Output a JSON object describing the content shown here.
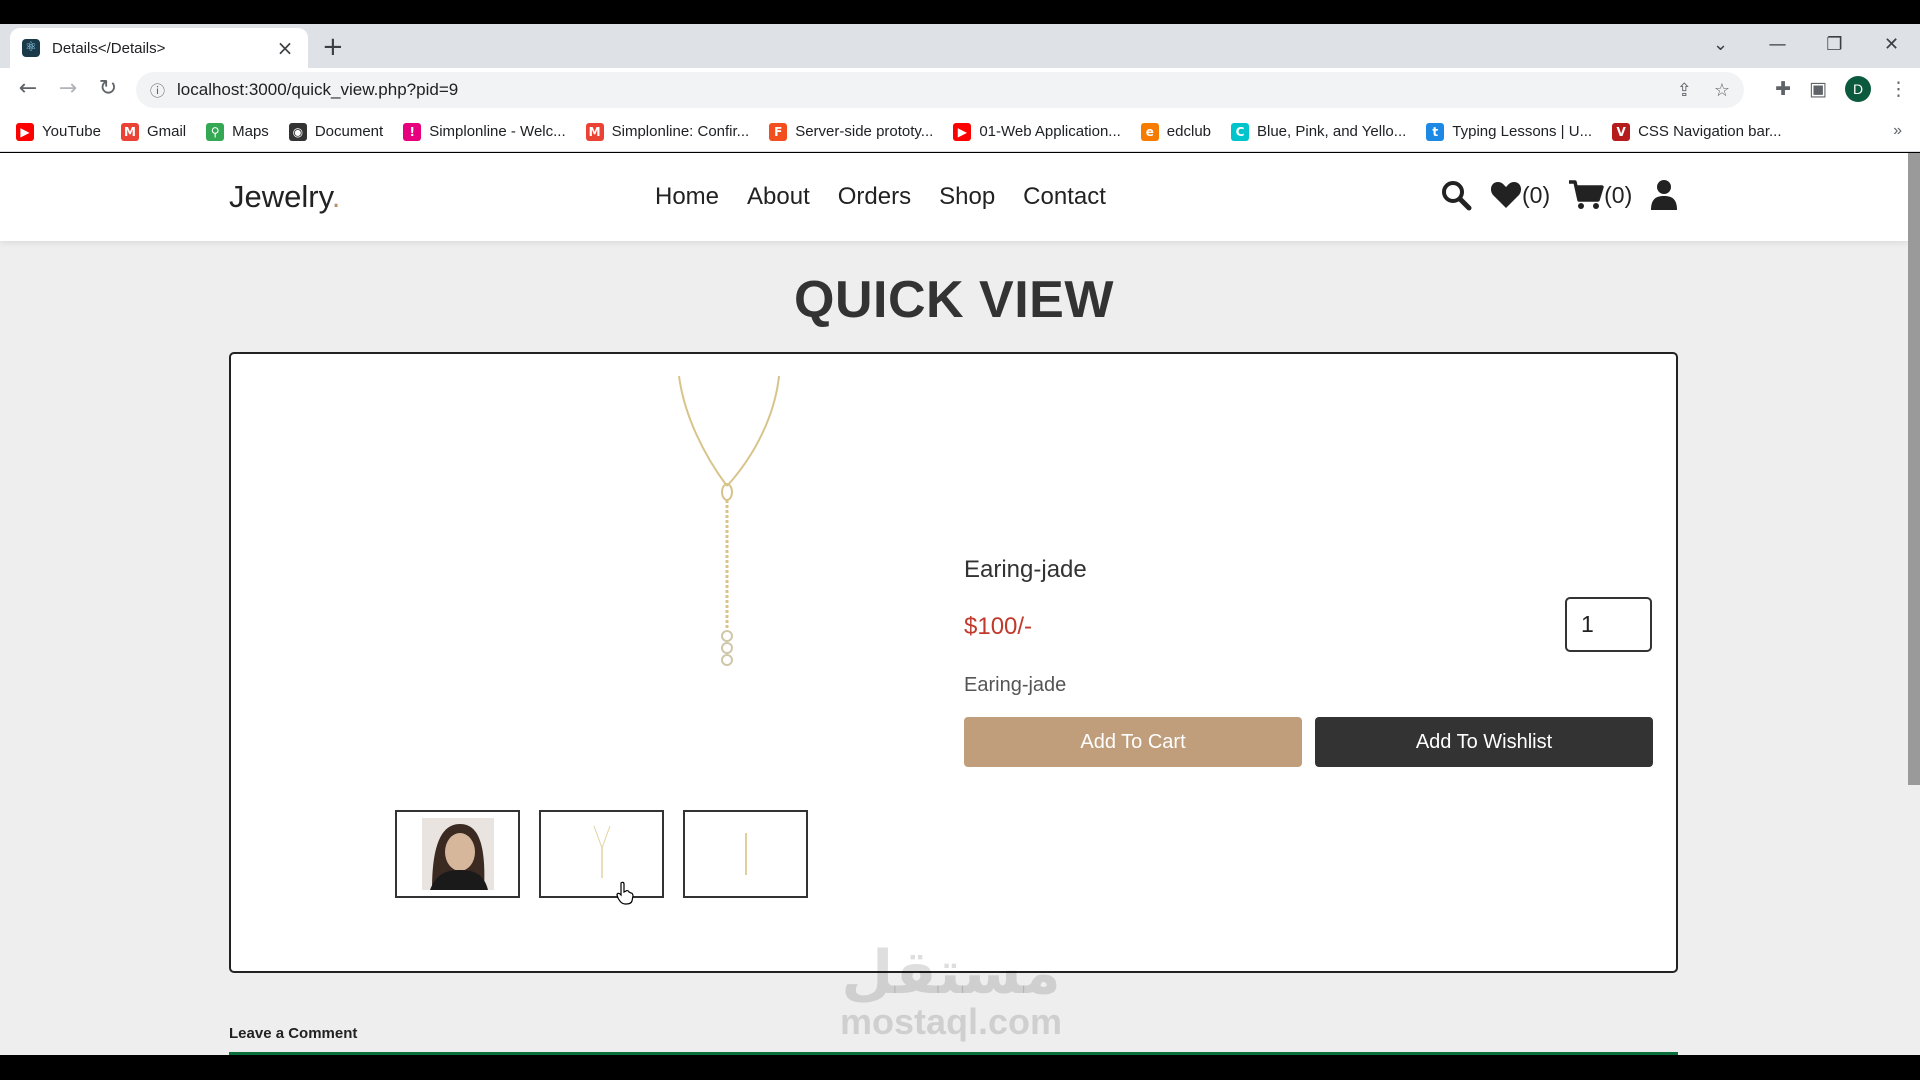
{
  "browser": {
    "tab_title": "Details</Details>",
    "url": "localhost:3000/quick_view.php?pid=9",
    "profile_initial": "D",
    "bookmarks": [
      {
        "label": "YouTube",
        "icon": "youtube-icon",
        "color": "#ff0000"
      },
      {
        "label": "Gmail",
        "icon": "gmail-icon",
        "color": "#ea4335"
      },
      {
        "label": "Maps",
        "icon": "maps-icon",
        "color": "#34a853"
      },
      {
        "label": "Document",
        "icon": "globe-icon",
        "color": "#333333"
      },
      {
        "label": "Simplonline - Welc...",
        "icon": "simplon-icon",
        "color": "#e6007e"
      },
      {
        "label": "Simplonline: Confir...",
        "icon": "gmail-icon",
        "color": "#ea4335"
      },
      {
        "label": "Server-side prototy...",
        "icon": "figma-icon",
        "color": "#f24e1e"
      },
      {
        "label": "01-Web Application...",
        "icon": "youtube-icon",
        "color": "#ff0000"
      },
      {
        "label": "edclub",
        "icon": "edclub-icon",
        "color": "#f57c00"
      },
      {
        "label": "Blue, Pink, and Yello...",
        "icon": "canva-icon",
        "color": "#00c4cc"
      },
      {
        "label": "Typing Lessons | U...",
        "icon": "typing-icon",
        "color": "#1e88e5"
      },
      {
        "label": "CSS Navigation bar...",
        "icon": "vue-icon",
        "color": "#b71c1c"
      }
    ]
  },
  "site": {
    "logo": "Jewelry",
    "logo_dot": ".",
    "nav": [
      "Home",
      "About",
      "Orders",
      "Shop",
      "Contact"
    ],
    "wishlist_count": "(0)",
    "cart_count": "(0)"
  },
  "page": {
    "title": "QUICK VIEW",
    "product": {
      "name": "Earing-jade",
      "price": "$100/-",
      "quantity": "1",
      "details": "Earing-jade",
      "add_to_cart": "Add To Cart",
      "add_to_wishlist": "Add To Wishlist"
    },
    "comment_label": "Leave a Comment"
  },
  "watermark": {
    "arabic": "مستقل",
    "latin": "mostaql.com"
  }
}
